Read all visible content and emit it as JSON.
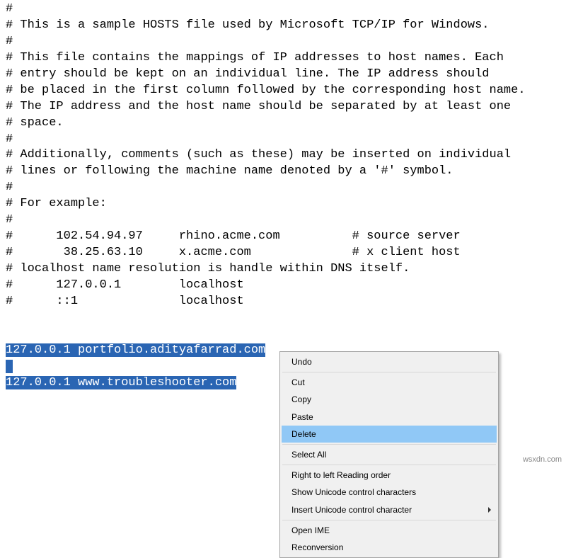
{
  "editor": {
    "lines": [
      "#",
      "# This is a sample HOSTS file used by Microsoft TCP/IP for Windows.",
      "#",
      "# This file contains the mappings of IP addresses to host names. Each",
      "# entry should be kept on an individual line. The IP address should",
      "# be placed in the first column followed by the corresponding host name.",
      "# The IP address and the host name should be separated by at least one",
      "# space.",
      "#",
      "# Additionally, comments (such as these) may be inserted on individual",
      "# lines or following the machine name denoted by a '#' symbol.",
      "#",
      "# For example:",
      "#",
      "#      102.54.94.97     rhino.acme.com          # source server",
      "#       38.25.63.10     x.acme.com              # x client host",
      "# localhost name resolution is handle within DNS itself.",
      "#      127.0.0.1        localhost",
      "#      ::1              localhost",
      "",
      ""
    ],
    "selected": [
      "127.0.0.1 portfolio.adityafarrad.com",
      "",
      "127.0.0.1 www.troubleshooter.com"
    ]
  },
  "context_menu": {
    "groups": [
      {
        "items": [
          {
            "label": "Undo"
          }
        ]
      },
      {
        "items": [
          {
            "label": "Cut"
          },
          {
            "label": "Copy"
          },
          {
            "label": "Paste"
          },
          {
            "label": "Delete",
            "highlight": true
          }
        ]
      },
      {
        "items": [
          {
            "label": "Select All"
          }
        ]
      },
      {
        "items": [
          {
            "label": "Right to left Reading order"
          },
          {
            "label": "Show Unicode control characters"
          },
          {
            "label": "Insert Unicode control character",
            "submenu": true
          }
        ]
      },
      {
        "items": [
          {
            "label": "Open IME"
          },
          {
            "label": "Reconversion"
          }
        ]
      }
    ]
  },
  "watermark": "wsxdn.com"
}
